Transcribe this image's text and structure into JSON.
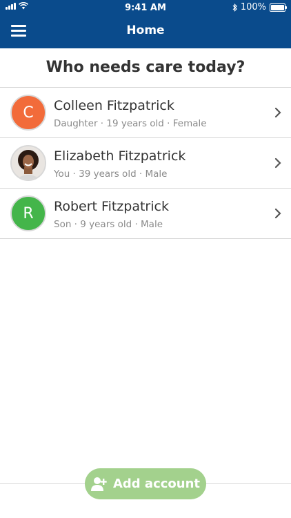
{
  "status": {
    "time": "9:41 AM",
    "battery": "100%"
  },
  "header": {
    "title": "Home"
  },
  "prompt": "Who needs care today?",
  "people": [
    {
      "initial": "C",
      "name": "Colleen Fitzpatrick",
      "meta": "Daughter · 19 years old · Female",
      "avatar_color": "#f26b3a"
    },
    {
      "initial": "",
      "name": "Elizabeth Fitzpatrick",
      "meta": "You · 39 years old · Male",
      "avatar_color": "#e9e5e1"
    },
    {
      "initial": "R",
      "name": "Robert Fitzpatrick",
      "meta": "Son · 9 years old · Male",
      "avatar_color": "#44b54a"
    }
  ],
  "add_button": {
    "label": "Add account"
  },
  "colors": {
    "header": "#0a4b8c",
    "add_button": "#a3d18d"
  }
}
